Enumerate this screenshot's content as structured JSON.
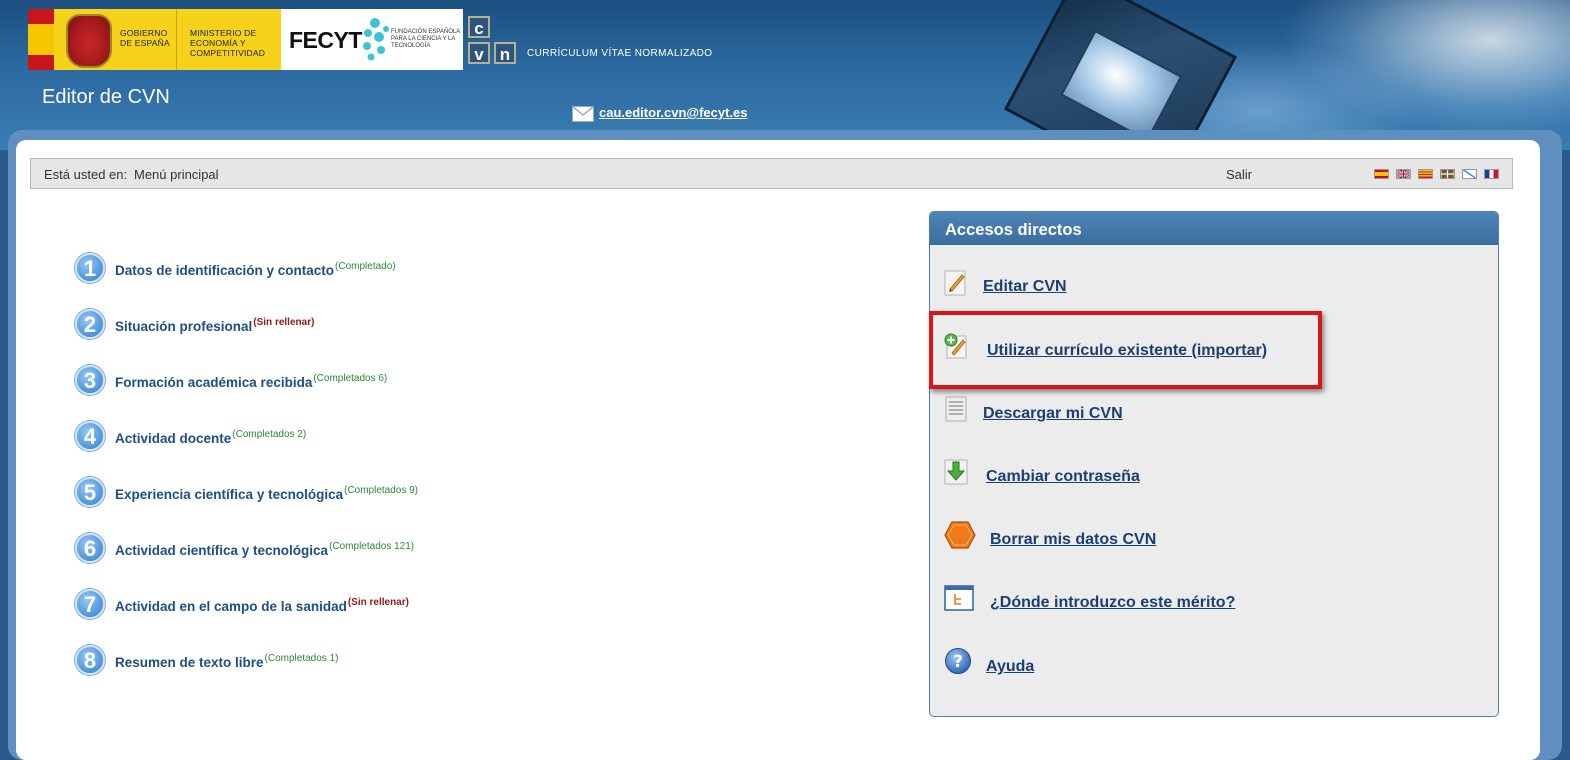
{
  "header": {
    "gov_line1": "GOBIERNO DE ESPAÑA",
    "gov_line2": "MINISTERIO DE ECONOMÍA Y COMPETITIVIDAD",
    "fecyt_name": "FECYT",
    "fecyt_sub": "FUNDACIÓN ESPAÑOLA PARA LA CIENCIA Y LA TECNOLOGÍA",
    "cvn_letters": [
      "c",
      "v",
      "n"
    ],
    "cvn_label": "CURRÍCULUM VÍTAE NORMALIZADO",
    "app_title": "Editor de CVN",
    "support_email": "cau.editor.cvn@fecyt.es"
  },
  "breadcrumb": {
    "prefix": "Está usted en:",
    "current": "Menú principal",
    "exit_label": "Salir",
    "languages": [
      "es",
      "en",
      "ca",
      "eu",
      "gl",
      "fr"
    ]
  },
  "sections": [
    {
      "number": "1",
      "label": "Datos de identificación y contacto",
      "status": "(Completado)",
      "state": "done"
    },
    {
      "number": "2",
      "label": "Situación profesional",
      "status": "(Sin rellenar)",
      "state": "empty"
    },
    {
      "number": "3",
      "label": "Formación académica recibida",
      "status": "(Completados 6)",
      "state": "done"
    },
    {
      "number": "4",
      "label": "Actividad docente",
      "status": "(Completados 2)",
      "state": "done"
    },
    {
      "number": "5",
      "label": "Experiencia científica y tecnológica",
      "status": "(Completados 9)",
      "state": "done"
    },
    {
      "number": "6",
      "label": "Actividad científica y tecnológica",
      "status": "(Completados 121)",
      "state": "done"
    },
    {
      "number": "7",
      "label": "Actividad en el campo de la sanidad",
      "status": "(Sin rellenar)",
      "state": "empty"
    },
    {
      "number": "8",
      "label": "Resumen de texto libre",
      "status": "(Completados 1)",
      "state": "done"
    }
  ],
  "panel": {
    "title": "Accesos directos",
    "items": [
      {
        "label": "Editar CVN",
        "icon": "edit-icon"
      },
      {
        "label": "Utilizar currículo existente (importar)",
        "icon": "import-icon"
      },
      {
        "label": "Descargar mi CVN",
        "icon": "document-icon"
      },
      {
        "label": "Cambiar contraseña",
        "icon": "download-arrow-icon"
      },
      {
        "label": "Borrar mis datos CVN",
        "icon": "stop-icon"
      },
      {
        "label": "¿Dónde introduzco este mérito?",
        "icon": "tree-icon"
      },
      {
        "label": "Ayuda",
        "icon": "help-icon"
      }
    ]
  },
  "colors": {
    "accent": "#1e4f82",
    "completed": "#2b8a35",
    "empty": "#8e1a1a",
    "highlight": "#d81618"
  }
}
